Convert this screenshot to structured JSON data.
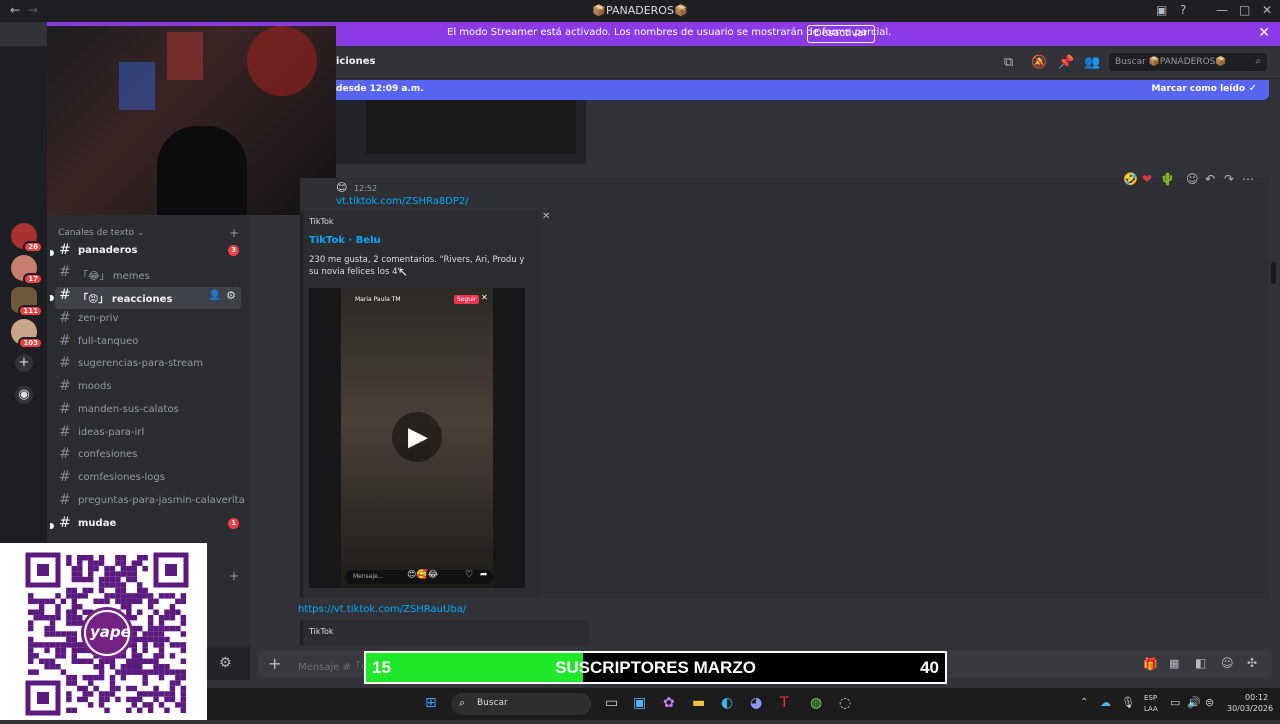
{
  "window": {
    "title": "📦PANADEROS📦"
  },
  "streamer_banner": {
    "message": "El modo Streamer está activado. Los nombres de usuario se mostrarán de forma parcial.",
    "button": "Desactivar"
  },
  "sidebar": {
    "category": "Canales de texto",
    "channels": [
      {
        "name": "panaderos",
        "badge": "3"
      },
      {
        "name": "memes",
        "prefix": "「😂」"
      },
      {
        "name": "reacciones",
        "prefix": "「😡」"
      },
      {
        "name": "zen-priv"
      },
      {
        "name": "full-tanqueo"
      },
      {
        "name": "sugerencias-para-stream"
      },
      {
        "name": "moods"
      },
      {
        "name": "manden-sus-calatos"
      },
      {
        "name": "ideas-para-irl"
      },
      {
        "name": "confesiones"
      },
      {
        "name": "comfesiones-logs"
      },
      {
        "name": "preguntas-para-jasmin-calaverita"
      },
      {
        "name": "mudae",
        "badge": "1"
      }
    ]
  },
  "servers": [
    {
      "badge": "26"
    },
    {
      "badge": "17"
    },
    {
      "badge": "111"
    },
    {
      "badge": "103"
    }
  ],
  "header": {
    "channel": "iciones",
    "search_placeholder": "Buscar 📦PANADEROS📦"
  },
  "new_messages": {
    "since": "desde 12:09 a.m.",
    "mark_read": "Marcar como leído"
  },
  "message": {
    "time": "12:52",
    "link1": "vt.tiktok.com/ZSHRa8DP2/",
    "embed": {
      "provider": "TikTok",
      "title": "TikTok · Belu",
      "description": "230 me gusta, 2 comentarios. \"Rivers, Ari, Produ y su novia felices los 4\"",
      "video_user": "Maria Paula TM",
      "video_follow": "Seguir",
      "video_input": "Mensaje..."
    },
    "link2": "https://vt.tiktok.com/ZSHRauUba/",
    "provider2": "TikTok"
  },
  "composer": {
    "placeholder": "Mensaje #「😡」"
  },
  "subs_bar": {
    "current": "15",
    "label": "SUSCRIPTORES MARZO",
    "goal": "40",
    "progress": 0.375
  },
  "qr": {
    "label": "yape"
  },
  "taskbar": {
    "search": "Buscar",
    "lang1": "ESP",
    "lang2": "LAA",
    "time": "00:12",
    "date": "30/03/2026"
  }
}
